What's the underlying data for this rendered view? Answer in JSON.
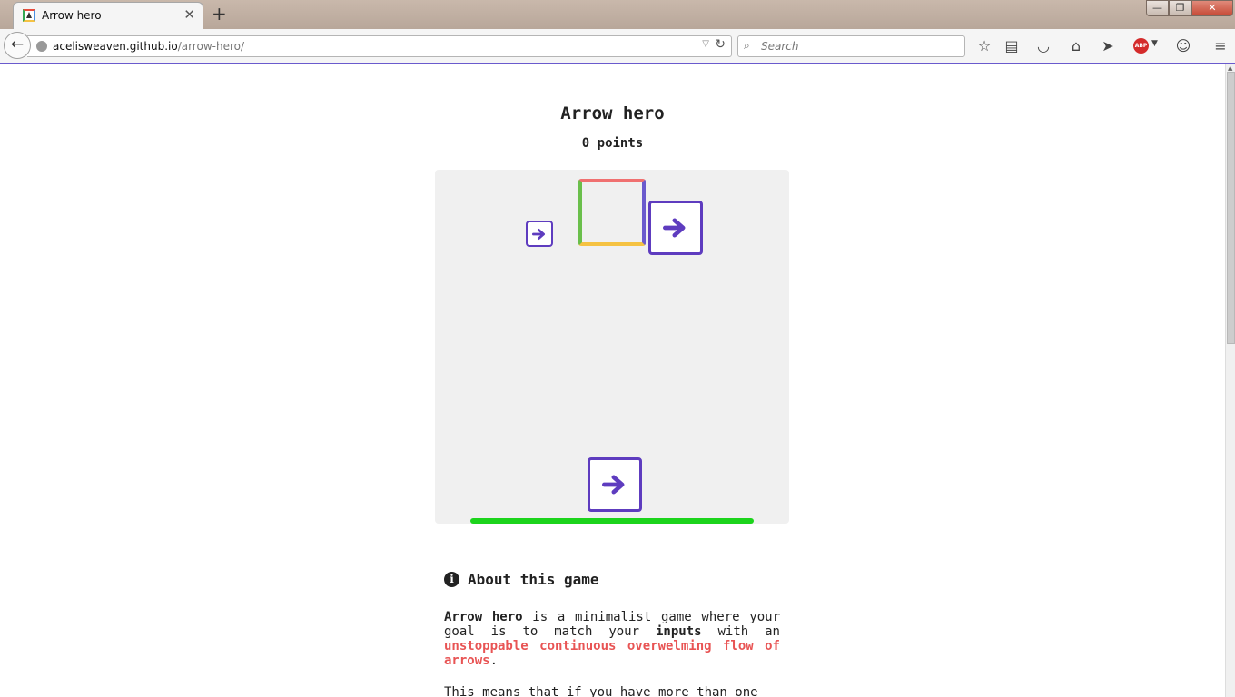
{
  "browser": {
    "tab_title": "Arrow hero",
    "tab_close": "✕",
    "new_tab": "+",
    "url_domain": "acelisweaven.github.io",
    "url_path": "/arrow-hero/",
    "search_placeholder": "Search",
    "abp_label": "ABP",
    "window_min": "—",
    "window_max": "❐",
    "window_close": "✕"
  },
  "game": {
    "title": "Arrow hero",
    "score": "0 points",
    "health_fraction": 1.0,
    "target_colors": {
      "top": "#f07070",
      "right": "#6a5acd",
      "bottom": "#f5c242",
      "left": "#6abf4b"
    },
    "arrow_color": "#5e3cbf",
    "queue": [
      "right",
      "right"
    ],
    "input_arrow": "right"
  },
  "about": {
    "heading": "About this game",
    "p1_bold1": "Arrow hero",
    "p1_text1": " is a minimalist game where your goal is to match your ",
    "p1_bold2": "inputs",
    "p1_text2": " with an ",
    "p1_red": "unstoppable continuous overwelming flow of arrows",
    "p1_end": ".",
    "p2": "This means that if you have more than one"
  }
}
